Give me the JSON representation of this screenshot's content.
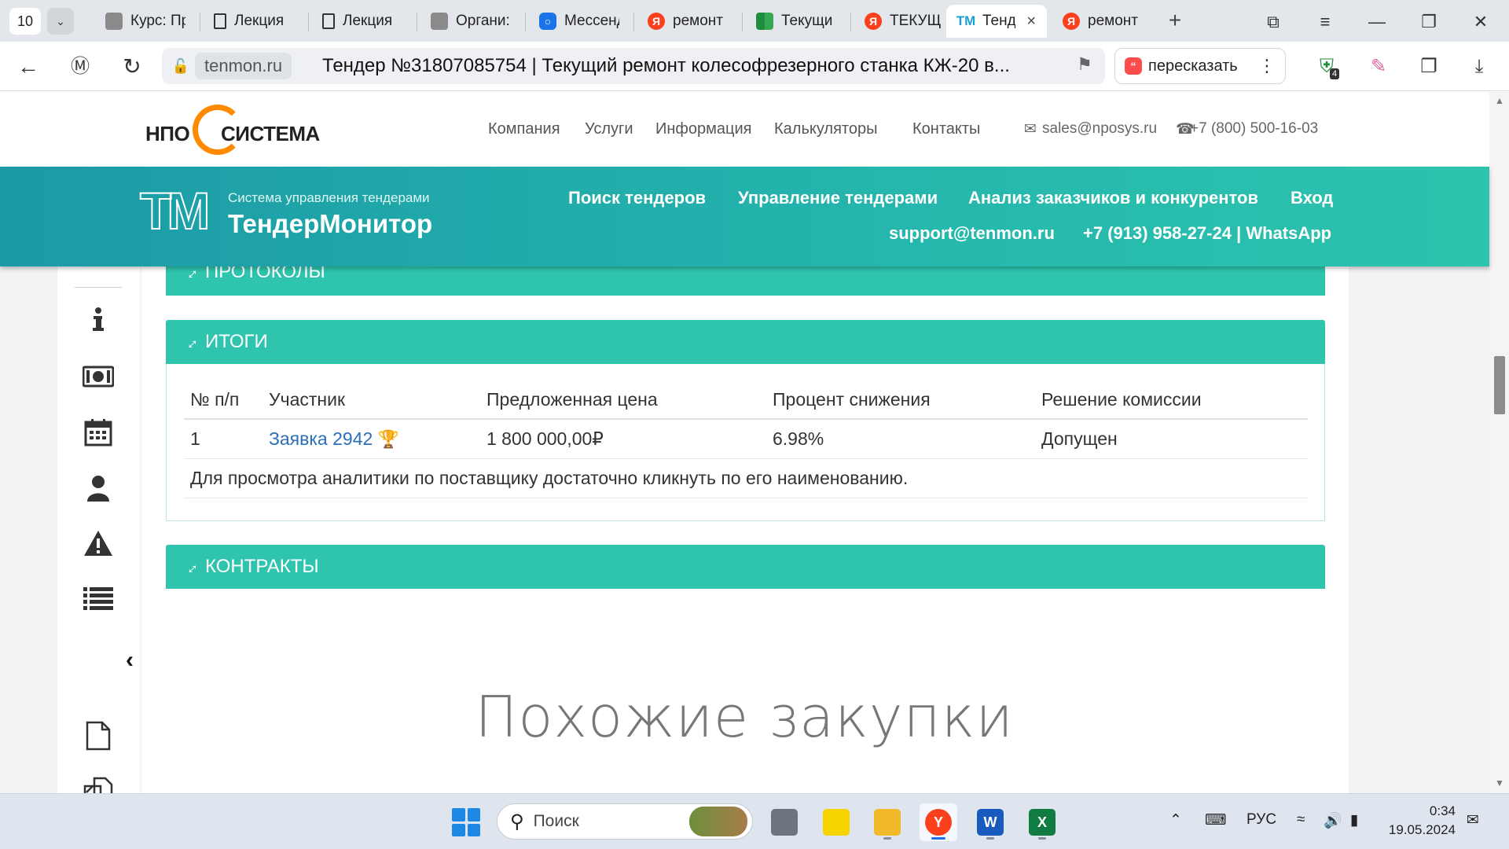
{
  "browser": {
    "tab_count": "10",
    "tabs": [
      {
        "label": "Курс: Пр",
        "icon": "gray-page-icon"
      },
      {
        "label": "Лекция",
        "icon": "page-icon"
      },
      {
        "label": "Лекция",
        "icon": "page-icon"
      },
      {
        "label": "Органи:",
        "icon": "gray-page-icon"
      },
      {
        "label": "Мессенд",
        "icon": "messenger-icon"
      },
      {
        "label": "ремонт",
        "icon": "yandex-icon"
      },
      {
        "label": "Текущи",
        "icon": "grid-icon"
      },
      {
        "label": "ТЕКУЩ",
        "icon": "yandex-icon"
      },
      {
        "label": "Тенд",
        "icon": "tm-icon"
      },
      {
        "label": "ремонт",
        "icon": "yandex-icon"
      }
    ],
    "domain": "tenmon.ru",
    "page_title": "Тендер №31807085754 | Текущий ремонт колесофрезерного станка КЖ-20 в...",
    "retell_label": "пересказать",
    "extension_badge": "4"
  },
  "site_header": {
    "logo_left": "НПО",
    "logo_right": "СИСТЕМА",
    "nav": [
      "Компания",
      "Услуги",
      "Информация",
      "Калькуляторы",
      "Контакты"
    ],
    "email": "sales@nposys.ru",
    "phone": "+7 (800) 500-16-03"
  },
  "tm_header": {
    "logo_mark": "TM",
    "subtitle": "Система управления тендерами",
    "name": "ТендерМонитор",
    "nav": [
      "Поиск тендеров",
      "Управление тендерами",
      "Анализ заказчиков и конкурентов",
      "Вход"
    ],
    "support_email": "support@tenmon.ru",
    "support_phone": "+7 (913) 958-27-24 | WhatsApp"
  },
  "panels": {
    "protocols": "ПРОТОКОЛЫ",
    "results": "ИТОГИ",
    "contracts": "КОНТРАКТЫ"
  },
  "results_table": {
    "headers": [
      "№ п/п",
      "Участник",
      "Предложенная цена",
      "Процент снижения",
      "Решение комиссии"
    ],
    "rows": [
      {
        "num": "1",
        "participant": "Заявка 2942",
        "price": "1 800 000,00₽",
        "reduction": "6.98%",
        "decision": "Допущен"
      }
    ],
    "note": "Для просмотра аналитики по поставщику достаточно кликнуть по его наименованию."
  },
  "similar_heading": "Похожие закупки",
  "taskbar": {
    "search_placeholder": "Поиск",
    "language": "РУС",
    "time": "0:34",
    "date": "19.05.2024"
  },
  "colors": {
    "teal": "#2ec4ad",
    "teal_dark": "#1b9aa6",
    "link": "#2a6fb8",
    "orange": "#ff8a00"
  }
}
